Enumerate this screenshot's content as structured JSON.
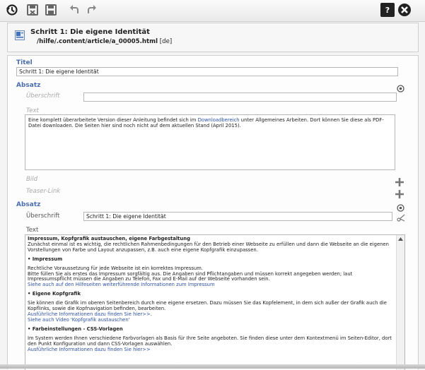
{
  "toolbar": {
    "icons": [
      "history-icon",
      "discard-icon",
      "save-icon",
      "undo-icon",
      "redo-icon",
      "help-icon",
      "close-icon"
    ]
  },
  "header": {
    "title": "Schritt 1: Die eigene Identität",
    "path": "/hilfe/.content/article/a_00005.html",
    "locale": "[de]"
  },
  "form": {
    "titel_label": "Titel",
    "titel_value": "Schritt 1: Die eigene Identität",
    "absatz1": {
      "label": "Absatz",
      "ueberschrift_label": "Überschrift",
      "ueberschrift_value": "",
      "text_label": "Text",
      "text_part1": "Eine komplett überarbeitete Version dieser Anleitung befindet sich im ",
      "text_link": "Downloadbereich",
      "text_part2": " unter Allgemeines Arbeiten. Dort können Sie diese als PDF-Datei downloaden. Die Seiten hier sind noch nicht auf dem aktuellen Stand (April 2015).",
      "bild_label": "Bild",
      "teaser_label": "Teaser-Link"
    },
    "absatz2": {
      "label": "Absatz",
      "ueberschrift_label": "Überschrift",
      "ueberschrift_value": "Schritt 1: Die eigene Identität",
      "text_label": "Text",
      "rich": {
        "heading": "Impressum, Kopfgrafik austauschen, eigene Farbgestaltung",
        "intro": "Zunächst einmal ist es wichtig, die rechtlichen Rahmenbedingungen für den Betrieb einer Webseite zu erfüllen und dann die Webseite an die eigenen Vorstellungen von Farbe und Layout anzupassen, z.B. auch eine eigene Kopfgrafik einzupassen.",
        "s1_title": "• Impressum",
        "s1_p1": "Rechtliche Voraussetzung für jede Webseite ist ein korrektes Impressum.",
        "s1_p2": "Bitte füllen Sie als erstes das Impressum sorgfältig aus. Die Angaben sind Pflichtangaben und müssen korrekt angegeben werden; laut Impressumspflicht müssen die Angaben zu Telefon, Fax und E-Mail auf der Webseite vorhanden sein.",
        "s1_link": "Siehe auch auf den Hilfeseiten weiterführende Informationen zum Impressum",
        "s2_title": "• Eigene Kopfgrafik",
        "s2_p1": "Sie können die Grafik im oberen Seitenbereich durch eine eigene ersetzen. Dazu müssen Sie das Kopfelement, in dem sich außer der Grafik auch die Kopflinks, sowie die Kopfnavigation befinden, bearbeiten.",
        "s2_link1": "Ausführliche Informationen dazu finden Sie hier>>.",
        "s2_link2": "Siehe auch Video 'Kopfgrafik austauschen'",
        "s3_title": "• Farbeinstellungen - CSS-Vorlagen",
        "s3_p1": "Im System werden Ihnen verschiedene Farbvorlagen als Basis für Ihre Seite angeboten. Sie finden diese unter dem Kontextmenü im Seiten-Editor, dort den Punkt Konfiguration und dann CSS-Vorlagen auswählen.",
        "s3_link": "Ausführliche Informationen dazu finden Sie hier>>"
      }
    }
  }
}
